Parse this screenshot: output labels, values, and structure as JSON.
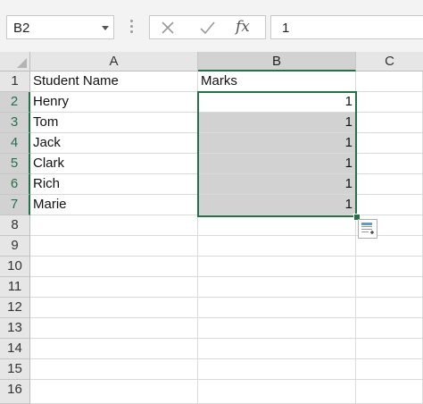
{
  "formula_bar": {
    "name_box": "B2",
    "cancel_icon": "close-icon",
    "enter_icon": "check-icon",
    "fx_label": "fx",
    "formula_value": "1"
  },
  "sheet": {
    "columns": [
      "A",
      "B",
      "C"
    ],
    "rows": [
      "1",
      "2",
      "3",
      "4",
      "5",
      "6",
      "7",
      "8",
      "9",
      "10",
      "11",
      "12",
      "13",
      "14",
      "15",
      "16"
    ],
    "cells": {
      "A1": "Student Name",
      "B1": "Marks",
      "A2": "Henry",
      "B2": "1",
      "A3": "Tom",
      "B3": "1",
      "A4": "Jack",
      "B4": "1",
      "A5": "Clark",
      "B5": "1",
      "A6": "Rich",
      "B6": "1",
      "A7": "Marie",
      "B7": "1"
    },
    "selection": "B2:B7",
    "accent_color": "#217346"
  },
  "quick_analysis_icon": "quick-analysis-icon"
}
